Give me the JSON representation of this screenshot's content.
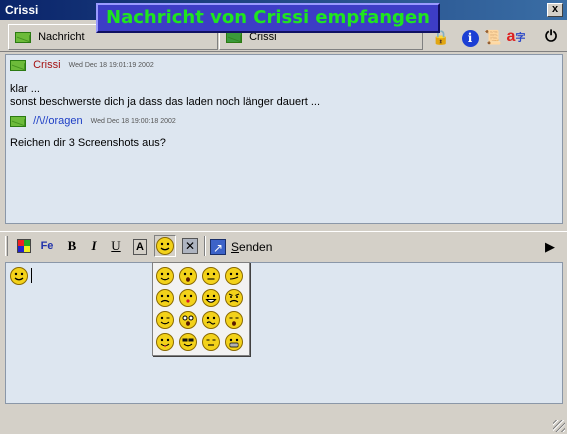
{
  "window": {
    "title": "Crissi",
    "close_glyph": "x"
  },
  "notification": {
    "text": "Nachricht von Crissi empfangen"
  },
  "toolbar": {
    "tabs": [
      {
        "label": "Nachricht",
        "icon": "envelope-icon"
      },
      {
        "label": "Crissi",
        "icon": "contact-icon"
      }
    ],
    "icons": [
      "lock-icon",
      "info-icon",
      "scroll-icon",
      "translate-icon",
      "power-icon"
    ]
  },
  "history": {
    "messages": [
      {
        "sender": "Crissi",
        "timestamp": "Wed Dec 18 19:01:19 2002",
        "lines": [
          "klar ...",
          "sonst beschwerste dich ja dass das laden noch länger dauert ..."
        ]
      },
      {
        "sender": "//\\//oragen",
        "timestamp": "Wed Dec 18 19:00:18 2002",
        "lines": [
          "Reichen dir 3 Screenshots aus?"
        ]
      }
    ]
  },
  "format_toolbar": {
    "bold": "B",
    "italic": "I",
    "underline": "U",
    "font_glyph": "A",
    "font_label": "Fe",
    "send_label": "Senden",
    "send_underline_char": "S"
  },
  "smiley_popup": {
    "rows": 4,
    "cols": 4,
    "faces": [
      "smile",
      "surprised",
      "neutral",
      "smirk",
      "sad",
      "kiss",
      "grin",
      "angry",
      "wink",
      "shocked",
      "confused",
      "yawn",
      "tongue",
      "cool",
      "sleepy",
      "big-grin"
    ]
  },
  "colors": {
    "title_start": "#0a246a",
    "notify_bg": "#3d3dc6",
    "notify_text": "#1fe51f",
    "pane_bg": "#dde6f0",
    "sender1": "#a51212",
    "sender2": "#1d3ec5"
  }
}
